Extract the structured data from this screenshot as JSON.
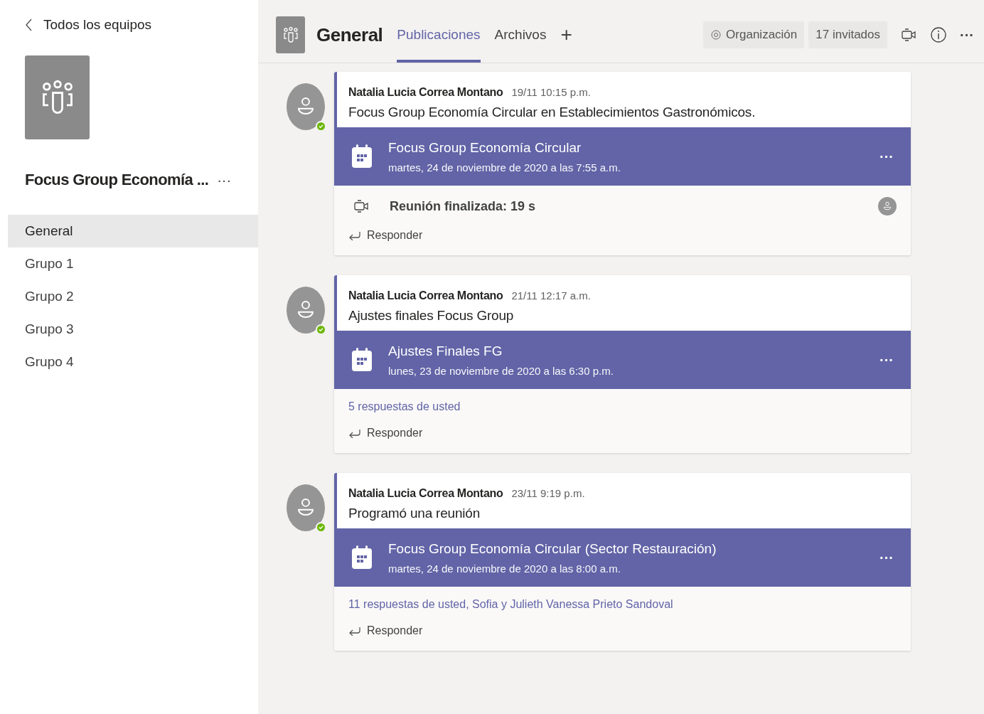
{
  "sidebar": {
    "back_label": "Todos los equipos",
    "team_name": "Focus Group Economía ...",
    "more": "···",
    "channels": [
      {
        "label": "General",
        "selected": true
      },
      {
        "label": "Grupo 1",
        "selected": false
      },
      {
        "label": "Grupo 2",
        "selected": false
      },
      {
        "label": "Grupo 3",
        "selected": false
      },
      {
        "label": "Grupo 4",
        "selected": false
      }
    ]
  },
  "header": {
    "channel": "General",
    "tabs": [
      {
        "label": "Publicaciones",
        "selected": true
      },
      {
        "label": "Archivos",
        "selected": false
      }
    ],
    "add": "+",
    "org": "Organización",
    "guests": "17 invitados",
    "more": "···"
  },
  "posts": [
    {
      "author": "Natalia Lucia Correa Montano",
      "time": "19/11 10:15 p.m.",
      "online": true,
      "body": "Focus Group Economía Circular en Establecimientos Gastronómicos.",
      "meeting": {
        "title": "Focus Group Economía Circular",
        "when": "martes, 24 de noviembre de 2020 a las 7:55 a.m.",
        "more": "···"
      },
      "footer": {
        "kind": "meeting_ended",
        "text": "Reunión finalizada: 19 s"
      },
      "reply": "Responder"
    },
    {
      "author": "Natalia Lucia Correa Montano",
      "time": "21/11 12:17 a.m.",
      "online": true,
      "body": "Ajustes finales Focus Group",
      "meeting": {
        "title": "Ajustes Finales FG",
        "when": "lunes, 23 de noviembre de 2020 a las 6:30 p.m.",
        "more": "···"
      },
      "footer": {
        "kind": "replies",
        "text": "5 respuestas de usted"
      },
      "reply": "Responder"
    },
    {
      "author": "Natalia Lucia Correa Montano",
      "time": "23/11 9:19 p.m.",
      "online": true,
      "body": "Programó una reunión",
      "meeting": {
        "title": "Focus Group Economía Circular (Sector Restauración)",
        "when": "martes, 24 de noviembre de 2020 a las 8:00 a.m.",
        "more": "···"
      },
      "footer": {
        "kind": "replies",
        "text": "11 respuestas de usted, Sofia y Julieth Vanessa Prieto Sandoval"
      },
      "reply": "Responder"
    }
  ]
}
